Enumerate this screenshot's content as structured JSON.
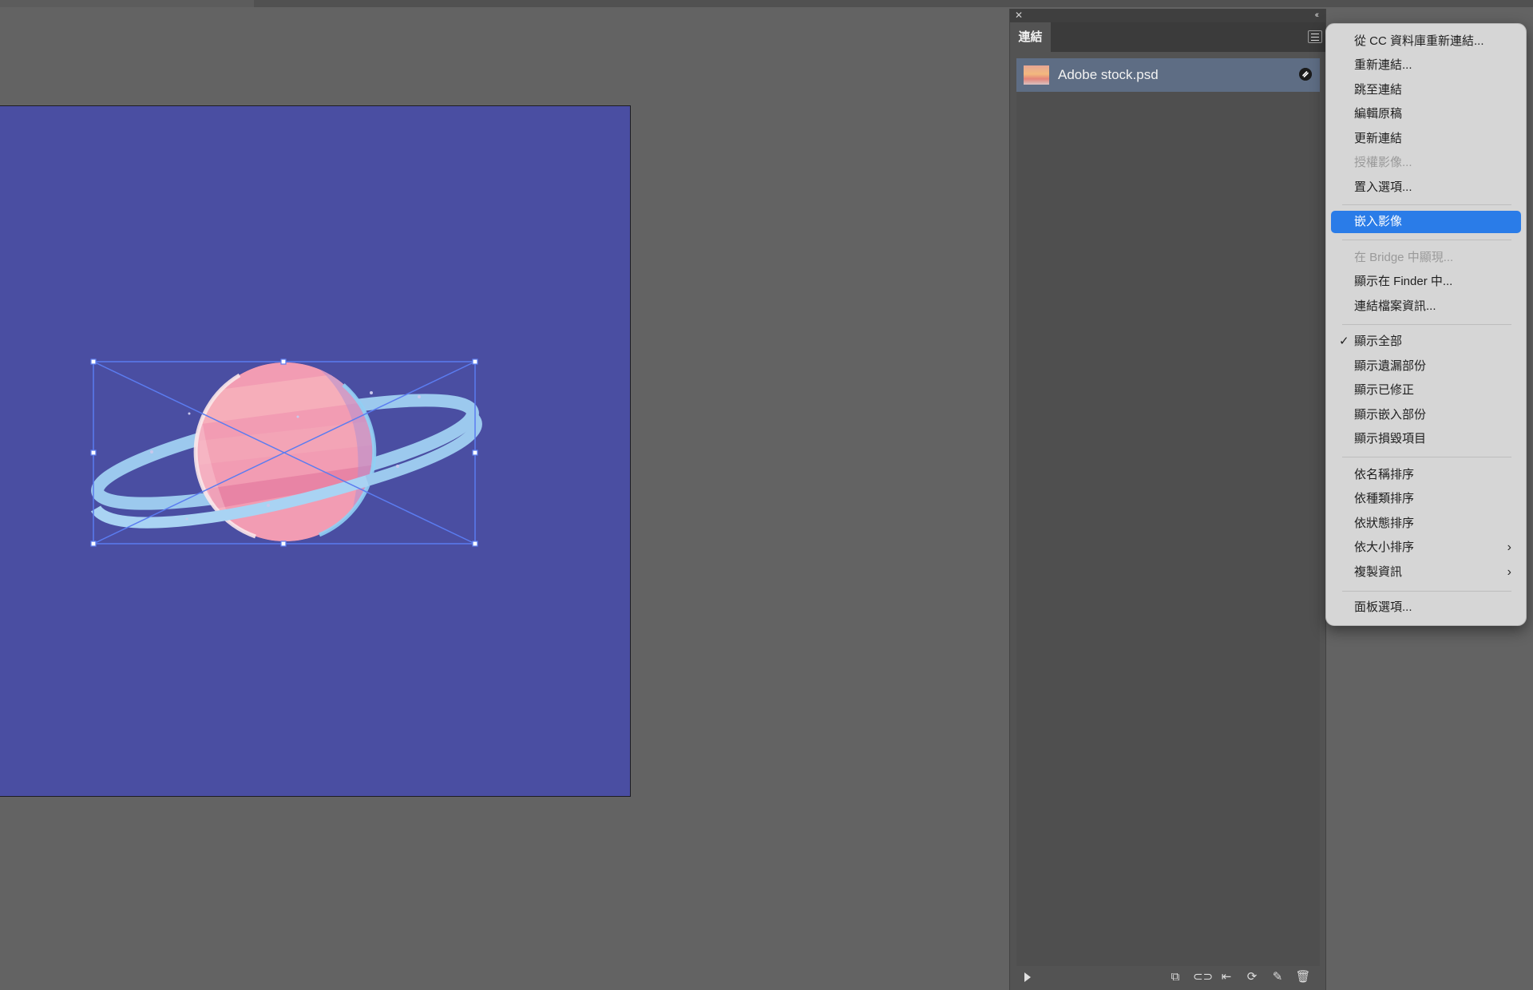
{
  "panel": {
    "tab_label": "連結",
    "close_glyph": "✕",
    "collapse_glyph": "‹‹",
    "items": [
      {
        "name": "Adobe stock.psd"
      }
    ],
    "footer_icons": [
      "⧉",
      "⊂⊃",
      "⇤",
      "⟳",
      "✎",
      "🗑"
    ]
  },
  "menu": {
    "items": [
      {
        "label": "從 CC 資料庫重新連結...",
        "disabled": false
      },
      {
        "label": "重新連結...",
        "disabled": false
      },
      {
        "label": "跳至連結",
        "disabled": false
      },
      {
        "label": "編輯原稿",
        "disabled": false
      },
      {
        "label": "更新連結",
        "disabled": false
      },
      {
        "label": "授權影像...",
        "disabled": true
      },
      {
        "label": "置入選項...",
        "disabled": false
      },
      {
        "label": "嵌入影像",
        "disabled": false,
        "active": true
      },
      {
        "label": "在 Bridge 中顯現...",
        "disabled": true
      },
      {
        "label": "顯示在 Finder 中...",
        "disabled": false
      },
      {
        "label": "連結檔案資訊...",
        "disabled": false
      },
      {
        "label": "顯示全部",
        "disabled": false,
        "checked": true,
        "check_glyph": "✓"
      },
      {
        "label": "顯示遺漏部份",
        "disabled": false
      },
      {
        "label": "顯示已修正",
        "disabled": false
      },
      {
        "label": "顯示嵌入部份",
        "disabled": false
      },
      {
        "label": "顯示損毀項目",
        "disabled": false
      },
      {
        "label": "依名稱排序",
        "disabled": false
      },
      {
        "label": "依種類排序",
        "disabled": false
      },
      {
        "label": "依狀態排序",
        "disabled": false
      },
      {
        "label": "依大小排序",
        "disabled": false,
        "submenu": true,
        "submenu_glyph": "›"
      },
      {
        "label": "複製資訊",
        "disabled": false,
        "submenu": true,
        "submenu_glyph": "›"
      },
      {
        "label": "面板選項...",
        "disabled": false
      }
    ]
  },
  "colors": {
    "artboard": "#4a4ea2",
    "workspace": "#636363",
    "selection": "#5b7cf0",
    "menu_highlight": "#2a7ce8"
  }
}
